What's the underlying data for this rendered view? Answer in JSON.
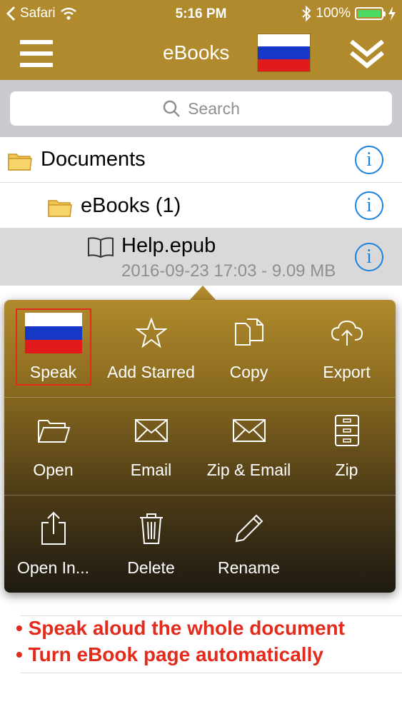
{
  "status_bar": {
    "carrier": "Safari",
    "time": "5:16 PM",
    "battery": "100%"
  },
  "nav": {
    "title": "eBooks"
  },
  "search": {
    "placeholder": "Search"
  },
  "list": {
    "documents": "Documents",
    "ebooks_folder": "eBooks (1)",
    "file_name": "Help.epub",
    "file_meta": "2016-09-23 17:03 - 9.09 MB",
    "info_glyph": "i"
  },
  "actions": {
    "speak": "Speak",
    "add_starred": "Add Starred",
    "copy": "Copy",
    "export": "Export",
    "open": "Open",
    "email": "Email",
    "zip_email": "Zip & Email",
    "zip": "Zip",
    "open_in": "Open In...",
    "delete": "Delete",
    "rename": "Rename"
  },
  "caption": {
    "line1": "• Speak aloud the whole document",
    "line2": "• Turn eBook page automatically"
  },
  "colors": {
    "accent": "#b08a2c",
    "info_blue": "#1a82e0",
    "highlight_red": "#e32a1b"
  },
  "icons": [
    "wifi-icon",
    "bluetooth-icon",
    "battery-icon",
    "charging-icon",
    "menu-icon",
    "russia-flag-icon",
    "double-chevron-down-icon",
    "search-icon",
    "folder-icon",
    "book-icon",
    "info-icon",
    "star-icon",
    "copy-icon",
    "cloud-upload-icon",
    "folder-open-icon",
    "envelope-icon",
    "zip-cabinet-icon",
    "share-icon",
    "trash-icon",
    "pencil-icon"
  ]
}
